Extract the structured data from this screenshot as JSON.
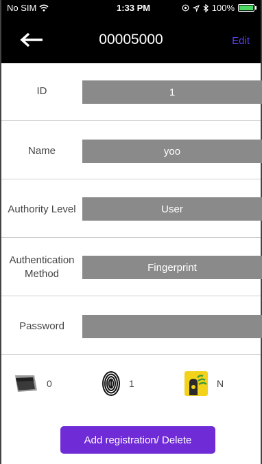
{
  "status_bar": {
    "carrier": "No SIM",
    "time": "1:33 PM",
    "battery": "100%"
  },
  "nav": {
    "title": "00005000",
    "edit_label": "Edit"
  },
  "fields": [
    {
      "label": "ID",
      "value": "1"
    },
    {
      "label": "Name",
      "value": "yoo"
    },
    {
      "label": "Authority Level",
      "value": "User"
    },
    {
      "label_line1": "Authentication",
      "label_line2": "Method",
      "value": "Fingerprint"
    },
    {
      "label": "Password",
      "value": ""
    }
  ],
  "credentials": {
    "card_count": "0",
    "fingerprint_count": "1",
    "mobile_status": "N"
  },
  "action_button": "Add registration/ Delete",
  "colors": {
    "accent": "#6f2bd6",
    "edit_link": "#5e3df2",
    "field_bg": "#8a8a8a",
    "header_bg": "#000000"
  },
  "icons": [
    "wifi-icon",
    "location-icon",
    "bluetooth-icon",
    "battery-icon",
    "back-arrow-icon",
    "card-icon",
    "fingerprint-icon",
    "mobile-key-icon"
  ]
}
